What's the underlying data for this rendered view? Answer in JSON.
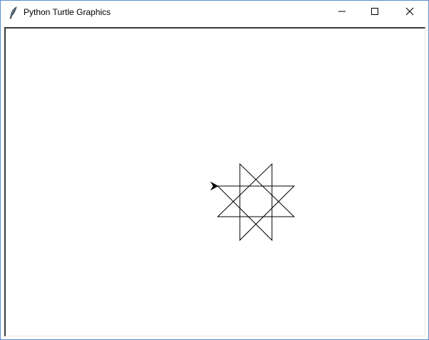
{
  "window": {
    "title": "Python Turtle Graphics",
    "icon": "feather-icon",
    "controls": {
      "minimize": "minimize-icon",
      "maximize": "maximize-icon",
      "close": "close-icon"
    }
  },
  "canvas": {
    "background": "#ffffff",
    "pen_color": "#000000",
    "turtle_shape": "classic-arrow",
    "turtle_heading": "east"
  }
}
